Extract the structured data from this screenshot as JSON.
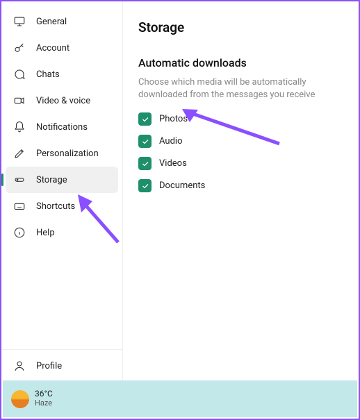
{
  "sidebar": {
    "items": [
      {
        "label": "General"
      },
      {
        "label": "Account"
      },
      {
        "label": "Chats"
      },
      {
        "label": "Video & voice"
      },
      {
        "label": "Notifications"
      },
      {
        "label": "Personalization"
      },
      {
        "label": "Storage"
      },
      {
        "label": "Shortcuts"
      },
      {
        "label": "Help"
      }
    ],
    "profile_label": "Profile"
  },
  "page": {
    "title": "Storage",
    "section_title": "Automatic downloads",
    "section_desc": "Choose which media will be automatically downloaded from the messages you receive"
  },
  "downloads": [
    {
      "label": "Photos",
      "checked": true
    },
    {
      "label": "Audio",
      "checked": true
    },
    {
      "label": "Videos",
      "checked": true
    },
    {
      "label": "Documents",
      "checked": true
    }
  ],
  "taskbar": {
    "temp": "36°C",
    "condition": "Haze"
  },
  "colors": {
    "accent": "#1d8f6a",
    "arrow": "#8a4fff"
  }
}
